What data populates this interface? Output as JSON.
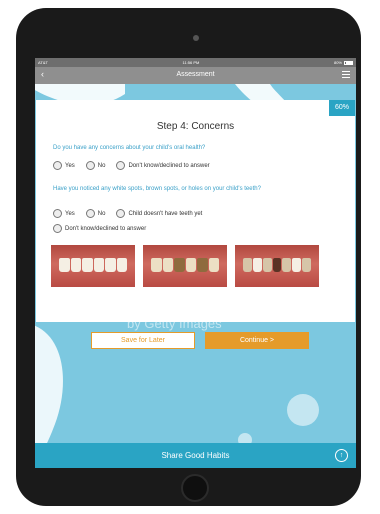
{
  "status_bar": {
    "carrier": "AT&T",
    "time": "11:56 PM",
    "battery": "80%"
  },
  "nav": {
    "back_icon": "‹",
    "title": "Assessment",
    "menu_icon": "hamburger-icon"
  },
  "progress": "60%",
  "step_title": "Step 4: Concerns",
  "question1": {
    "text": "Do you have any concerns about your child's oral health?",
    "options": [
      "Yes",
      "No",
      "Don't know/declined to answer"
    ]
  },
  "question2": {
    "text": "Have you noticed any white spots, brown spots, or holes on your child's teeth?",
    "options": [
      "Yes",
      "No",
      "Child doesn't have teeth yet",
      "Don't know/declined to answer"
    ]
  },
  "buttons": {
    "save": "Save for Later",
    "continue": "Continue  >"
  },
  "footer": {
    "label": "Share Good Habits",
    "share_icon": "↑"
  },
  "watermark": "by Getty Images",
  "colors": {
    "accent": "#2aa4c4",
    "orange": "#e59b2a",
    "question": "#3aa0c8",
    "background": "#7cc8e0"
  }
}
